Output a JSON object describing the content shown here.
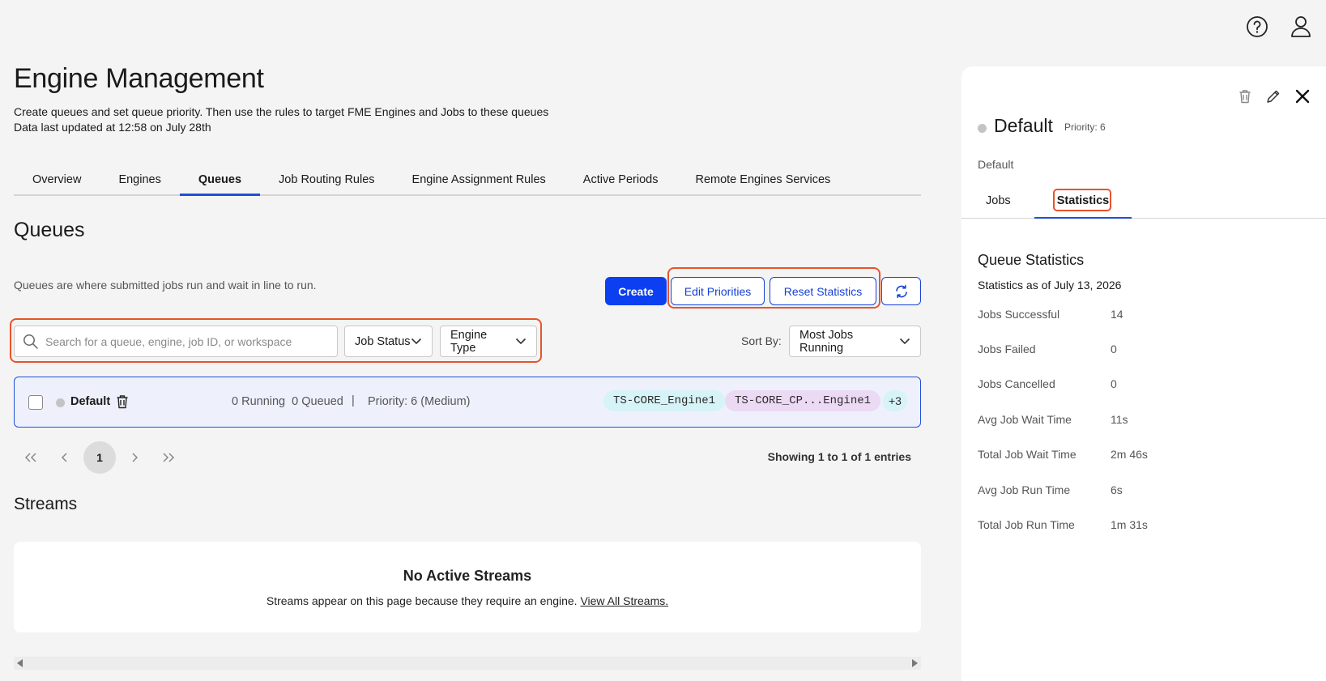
{
  "header": {
    "help_icon": "help-circle-icon",
    "user_icon": "user-icon"
  },
  "page": {
    "title": "Engine Management",
    "subtitle_line1": "Create queues and set queue priority. Then use the rules to target FME Engines and Jobs to these queues",
    "subtitle_line2": "Data last updated at 12:58 on July 28th"
  },
  "tabs": [
    {
      "label": "Overview"
    },
    {
      "label": "Engines"
    },
    {
      "label": "Queues",
      "active": true
    },
    {
      "label": "Job Routing Rules"
    },
    {
      "label": "Engine Assignment Rules"
    },
    {
      "label": "Active Periods"
    },
    {
      "label": "Remote Engines Services"
    }
  ],
  "queues": {
    "title": "Queues",
    "description": "Queues are where submitted jobs run and wait in line to run.",
    "create_label": "Create",
    "edit_priorities_label": "Edit Priorities",
    "reset_statistics_label": "Reset Statistics",
    "refresh_icon": "refresh-icon",
    "search_placeholder": "Search for a queue, engine, job ID, or workspace",
    "job_status_label": "Job Status",
    "engine_type_label": "Engine Type",
    "sort_by_label": "Sort By:",
    "sort_value": "Most Jobs Running",
    "rows": [
      {
        "name": "Default",
        "running": "0 Running",
        "queued": "0 Queued",
        "separator": "|",
        "priority": "Priority: 6 (Medium)",
        "engines": [
          "TS-CORE_Engine1",
          "TS-CORE_CP...Engine1"
        ],
        "more": "+3"
      }
    ],
    "pagination": {
      "current": "1",
      "showing": "Showing 1 to 1 of 1 entries"
    }
  },
  "streams": {
    "title": "Streams",
    "empty_title": "No Active Streams",
    "empty_desc": "Streams appear on this page because they require an engine.",
    "view_all_link": "View All Streams."
  },
  "panel": {
    "name": "Default",
    "priority": "Priority: 6",
    "description": "Default",
    "tabs": {
      "jobs": "Jobs",
      "statistics": "Statistics"
    },
    "stats_title": "Queue Statistics",
    "stats_as_of": "Statistics as of July 13, 2026",
    "stats": [
      {
        "label": "Jobs Successful",
        "value": "14"
      },
      {
        "label": "Jobs Failed",
        "value": "0"
      },
      {
        "label": "Jobs Cancelled",
        "value": "0"
      },
      {
        "label": "Avg Job Wait Time",
        "value": "11s"
      },
      {
        "label": "Total Job Wait Time",
        "value": "2m 46s"
      },
      {
        "label": "Avg Job Run Time",
        "value": "6s"
      },
      {
        "label": "Total Job Run Time",
        "value": "1m 31s"
      }
    ]
  },
  "colors": {
    "primary": "#0b3ff0",
    "highlight": "#e8532a",
    "tab_underline": "#1d4fd8"
  }
}
